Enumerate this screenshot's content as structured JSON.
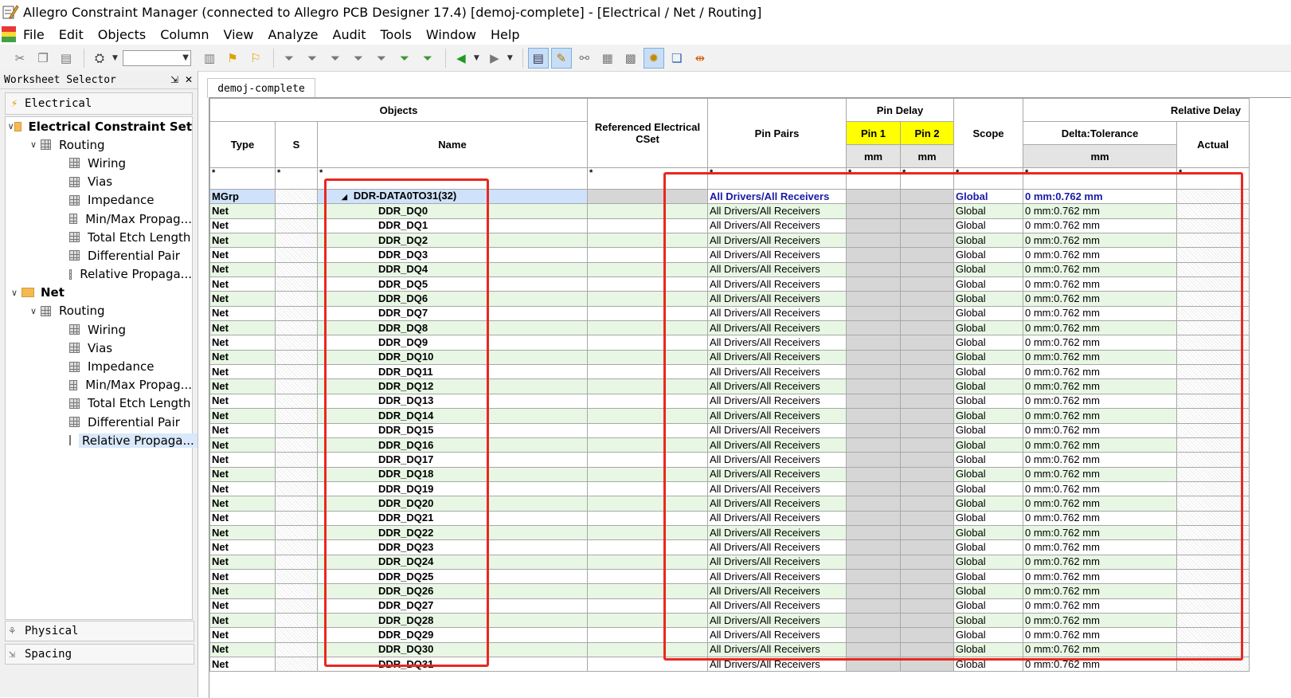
{
  "window": {
    "title": "Allegro Constraint Manager (connected to Allegro PCB Designer 17.4) [demoj-complete] - [Electrical / Net / Routing]"
  },
  "menu": [
    "File",
    "Edit",
    "Objects",
    "Column",
    "View",
    "Analyze",
    "Audit",
    "Tools",
    "Window",
    "Help"
  ],
  "toolbar": {
    "combo_value": ""
  },
  "worksheet": {
    "title": "Worksheet Selector",
    "pin_label": "⇲",
    "close_label": "✕",
    "section": "Electrical",
    "tree": [
      {
        "level": 0,
        "kind": "folder",
        "label": "Electrical Constraint Set",
        "bold": true,
        "expanded": true
      },
      {
        "level": 1,
        "kind": "group",
        "label": "Routing",
        "expanded": true
      },
      {
        "level": 2,
        "kind": "sheet",
        "label": "Wiring"
      },
      {
        "level": 2,
        "kind": "sheet",
        "label": "Vias"
      },
      {
        "level": 2,
        "kind": "sheet",
        "label": "Impedance"
      },
      {
        "level": 2,
        "kind": "sheet",
        "label": "Min/Max Propag..."
      },
      {
        "level": 2,
        "kind": "sheet",
        "label": "Total Etch Length"
      },
      {
        "level": 2,
        "kind": "sheet",
        "label": "Differential Pair"
      },
      {
        "level": 2,
        "kind": "sheet",
        "label": "Relative Propaga..."
      },
      {
        "level": 0,
        "kind": "folder",
        "label": "Net",
        "bold": true,
        "expanded": true
      },
      {
        "level": 1,
        "kind": "group",
        "label": "Routing",
        "expanded": true
      },
      {
        "level": 2,
        "kind": "sheet",
        "label": "Wiring"
      },
      {
        "level": 2,
        "kind": "sheet",
        "label": "Vias"
      },
      {
        "level": 2,
        "kind": "sheet",
        "label": "Impedance"
      },
      {
        "level": 2,
        "kind": "sheet",
        "label": "Min/Max Propag..."
      },
      {
        "level": 2,
        "kind": "sheet",
        "label": "Total Etch Length"
      },
      {
        "level": 2,
        "kind": "sheet",
        "label": "Differential Pair"
      },
      {
        "level": 2,
        "kind": "sheet",
        "label": "Relative Propaga...",
        "selected": true
      }
    ],
    "bottom_sections": [
      "Physical",
      "Spacing"
    ]
  },
  "document_tab": "demoj-complete",
  "grid": {
    "headers": {
      "objects": "Objects",
      "type": "Type",
      "s": "S",
      "name": "Name",
      "ref_cset": "Referenced Electrical CSet",
      "pin_pairs": "Pin Pairs",
      "pin_delay": "Pin Delay",
      "pin1": "Pin 1",
      "pin2": "Pin 2",
      "pin_unit": "mm",
      "scope": "Scope",
      "relative_delay": "Relative Delay",
      "delta_tol": "Delta:Tolerance",
      "delta_unit": "mm",
      "actual": "Actual"
    },
    "filter": "*",
    "mgrp": {
      "type": "MGrp",
      "name": "DDR-DATA0TO31(32)",
      "pin_pairs": "All Drivers/All Receivers",
      "scope": "Global",
      "delta": "0 mm:0.762 mm"
    },
    "rows": [
      {
        "type": "Net",
        "name": "DDR_DQ0",
        "pin_pairs": "All Drivers/All Receivers",
        "scope": "Global",
        "delta": "0 mm:0.762 mm"
      },
      {
        "type": "Net",
        "name": "DDR_DQ1",
        "pin_pairs": "All Drivers/All Receivers",
        "scope": "Global",
        "delta": "0 mm:0.762 mm"
      },
      {
        "type": "Net",
        "name": "DDR_DQ2",
        "pin_pairs": "All Drivers/All Receivers",
        "scope": "Global",
        "delta": "0 mm:0.762 mm"
      },
      {
        "type": "Net",
        "name": "DDR_DQ3",
        "pin_pairs": "All Drivers/All Receivers",
        "scope": "Global",
        "delta": "0 mm:0.762 mm"
      },
      {
        "type": "Net",
        "name": "DDR_DQ4",
        "pin_pairs": "All Drivers/All Receivers",
        "scope": "Global",
        "delta": "0 mm:0.762 mm"
      },
      {
        "type": "Net",
        "name": "DDR_DQ5",
        "pin_pairs": "All Drivers/All Receivers",
        "scope": "Global",
        "delta": "0 mm:0.762 mm"
      },
      {
        "type": "Net",
        "name": "DDR_DQ6",
        "pin_pairs": "All Drivers/All Receivers",
        "scope": "Global",
        "delta": "0 mm:0.762 mm"
      },
      {
        "type": "Net",
        "name": "DDR_DQ7",
        "pin_pairs": "All Drivers/All Receivers",
        "scope": "Global",
        "delta": "0 mm:0.762 mm"
      },
      {
        "type": "Net",
        "name": "DDR_DQ8",
        "pin_pairs": "All Drivers/All Receivers",
        "scope": "Global",
        "delta": "0 mm:0.762 mm"
      },
      {
        "type": "Net",
        "name": "DDR_DQ9",
        "pin_pairs": "All Drivers/All Receivers",
        "scope": "Global",
        "delta": "0 mm:0.762 mm"
      },
      {
        "type": "Net",
        "name": "DDR_DQ10",
        "pin_pairs": "All Drivers/All Receivers",
        "scope": "Global",
        "delta": "0 mm:0.762 mm"
      },
      {
        "type": "Net",
        "name": "DDR_DQ11",
        "pin_pairs": "All Drivers/All Receivers",
        "scope": "Global",
        "delta": "0 mm:0.762 mm"
      },
      {
        "type": "Net",
        "name": "DDR_DQ12",
        "pin_pairs": "All Drivers/All Receivers",
        "scope": "Global",
        "delta": "0 mm:0.762 mm"
      },
      {
        "type": "Net",
        "name": "DDR_DQ13",
        "pin_pairs": "All Drivers/All Receivers",
        "scope": "Global",
        "delta": "0 mm:0.762 mm"
      },
      {
        "type": "Net",
        "name": "DDR_DQ14",
        "pin_pairs": "All Drivers/All Receivers",
        "scope": "Global",
        "delta": "0 mm:0.762 mm"
      },
      {
        "type": "Net",
        "name": "DDR_DQ15",
        "pin_pairs": "All Drivers/All Receivers",
        "scope": "Global",
        "delta": "0 mm:0.762 mm"
      },
      {
        "type": "Net",
        "name": "DDR_DQ16",
        "pin_pairs": "All Drivers/All Receivers",
        "scope": "Global",
        "delta": "0 mm:0.762 mm"
      },
      {
        "type": "Net",
        "name": "DDR_DQ17",
        "pin_pairs": "All Drivers/All Receivers",
        "scope": "Global",
        "delta": "0 mm:0.762 mm"
      },
      {
        "type": "Net",
        "name": "DDR_DQ18",
        "pin_pairs": "All Drivers/All Receivers",
        "scope": "Global",
        "delta": "0 mm:0.762 mm"
      },
      {
        "type": "Net",
        "name": "DDR_DQ19",
        "pin_pairs": "All Drivers/All Receivers",
        "scope": "Global",
        "delta": "0 mm:0.762 mm"
      },
      {
        "type": "Net",
        "name": "DDR_DQ20",
        "pin_pairs": "All Drivers/All Receivers",
        "scope": "Global",
        "delta": "0 mm:0.762 mm"
      },
      {
        "type": "Net",
        "name": "DDR_DQ21",
        "pin_pairs": "All Drivers/All Receivers",
        "scope": "Global",
        "delta": "0 mm:0.762 mm"
      },
      {
        "type": "Net",
        "name": "DDR_DQ22",
        "pin_pairs": "All Drivers/All Receivers",
        "scope": "Global",
        "delta": "0 mm:0.762 mm"
      },
      {
        "type": "Net",
        "name": "DDR_DQ23",
        "pin_pairs": "All Drivers/All Receivers",
        "scope": "Global",
        "delta": "0 mm:0.762 mm"
      },
      {
        "type": "Net",
        "name": "DDR_DQ24",
        "pin_pairs": "All Drivers/All Receivers",
        "scope": "Global",
        "delta": "0 mm:0.762 mm"
      },
      {
        "type": "Net",
        "name": "DDR_DQ25",
        "pin_pairs": "All Drivers/All Receivers",
        "scope": "Global",
        "delta": "0 mm:0.762 mm"
      },
      {
        "type": "Net",
        "name": "DDR_DQ26",
        "pin_pairs": "All Drivers/All Receivers",
        "scope": "Global",
        "delta": "0 mm:0.762 mm"
      },
      {
        "type": "Net",
        "name": "DDR_DQ27",
        "pin_pairs": "All Drivers/All Receivers",
        "scope": "Global",
        "delta": "0 mm:0.762 mm"
      },
      {
        "type": "Net",
        "name": "DDR_DQ28",
        "pin_pairs": "All Drivers/All Receivers",
        "scope": "Global",
        "delta": "0 mm:0.762 mm"
      },
      {
        "type": "Net",
        "name": "DDR_DQ29",
        "pin_pairs": "All Drivers/All Receivers",
        "scope": "Global",
        "delta": "0 mm:0.762 mm"
      },
      {
        "type": "Net",
        "name": "DDR_DQ30",
        "pin_pairs": "All Drivers/All Receivers",
        "scope": "Global",
        "delta": "0 mm:0.762 mm"
      },
      {
        "type": "Net",
        "name": "DDR_DQ31",
        "pin_pairs": "All Drivers/All Receivers",
        "scope": "Global",
        "delta": "0 mm:0.762 mm"
      }
    ]
  },
  "colors": {
    "highlight_box": "#e8291f",
    "pin_header": "#ffff00",
    "row_green": "#e8f7e4",
    "mgrp_row": "#cfe2fb",
    "mgrp_text": "#1a1aa8"
  }
}
